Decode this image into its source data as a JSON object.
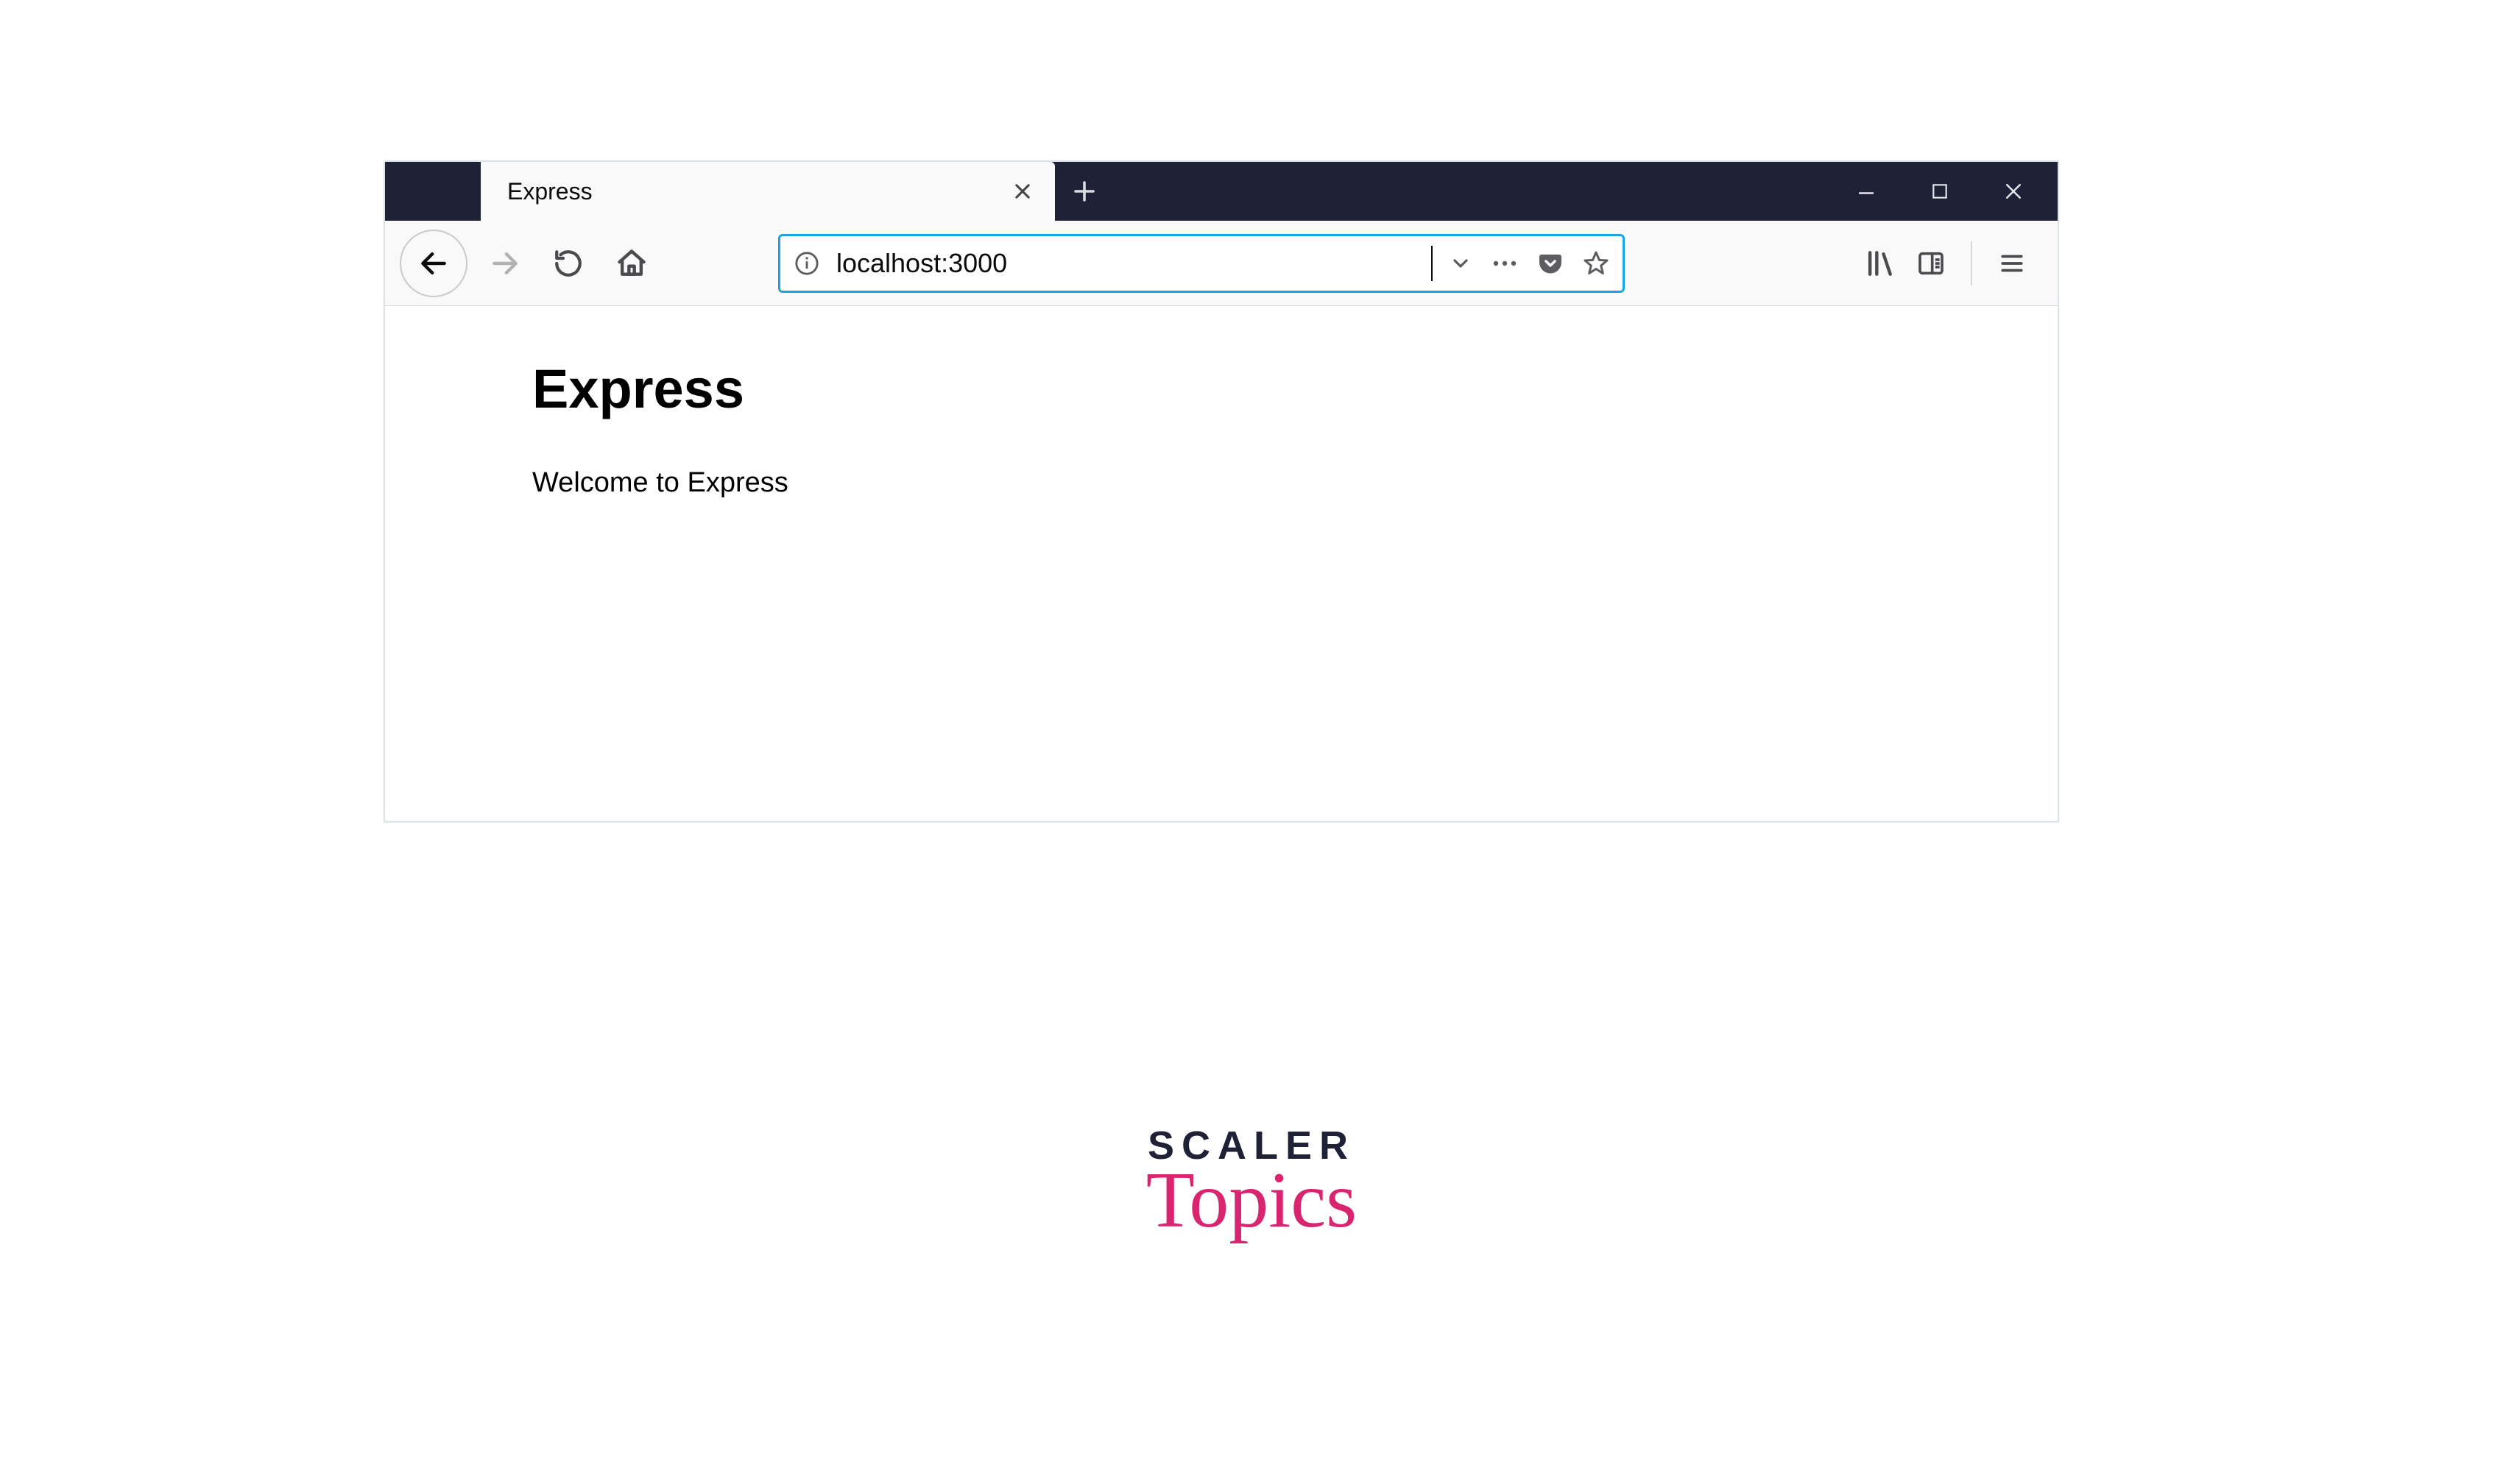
{
  "browser": {
    "tab": {
      "title": "Express"
    },
    "url": "localhost:3000"
  },
  "page": {
    "heading": "Express",
    "welcome": "Welcome to Express"
  },
  "watermark": {
    "line1": "SCALER",
    "line2": "Topics"
  }
}
